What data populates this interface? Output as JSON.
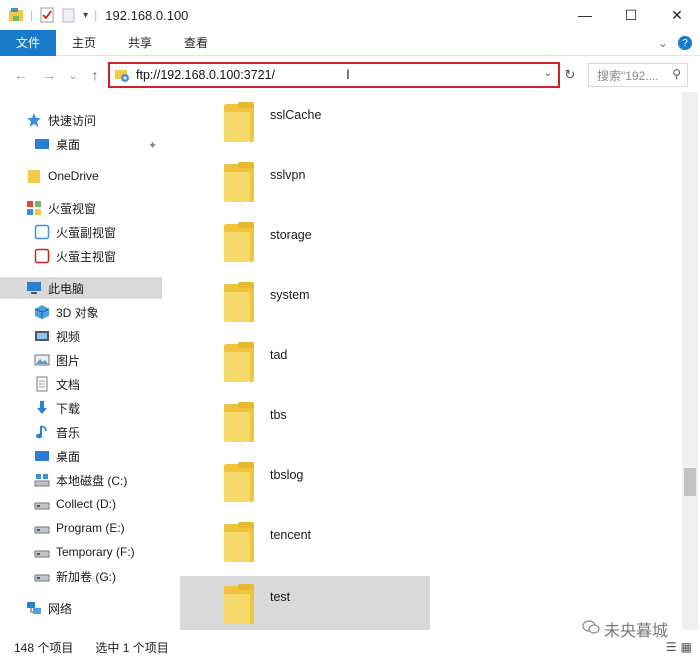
{
  "window": {
    "title": "192.168.0.100",
    "minimize": "—",
    "maximize": "☐",
    "close": "✕"
  },
  "ribbon": {
    "tabs": [
      "文件",
      "主页",
      "共享",
      "查看"
    ],
    "collapse": "⌄",
    "help": "?"
  },
  "nav": {
    "back": "←",
    "forward": "→",
    "recent": "⌄",
    "up": "↑",
    "address": "ftp://192.168.0.100:3721/",
    "refresh": "↻",
    "search_placeholder": "搜索\"192....",
    "search_icon": "⚲"
  },
  "sidebar": {
    "items": [
      {
        "label": "快速访问",
        "icon": "star-icon"
      },
      {
        "label": "桌面",
        "icon": "desktop-icon"
      },
      {
        "label": "OneDrive",
        "icon": "folder-icon"
      },
      {
        "label": "火萤视窗",
        "icon": "app-icon"
      },
      {
        "label": "火萤副视窗",
        "icon": "app-icon"
      },
      {
        "label": "火萤主视窗",
        "icon": "app-icon"
      },
      {
        "label": "此电脑",
        "icon": "computer-icon"
      },
      {
        "label": "3D 对象",
        "icon": "3d-icon"
      },
      {
        "label": "视频",
        "icon": "video-icon"
      },
      {
        "label": "图片",
        "icon": "picture-icon"
      },
      {
        "label": "文档",
        "icon": "document-icon"
      },
      {
        "label": "下载",
        "icon": "download-icon"
      },
      {
        "label": "音乐",
        "icon": "music-icon"
      },
      {
        "label": "桌面",
        "icon": "desktop-icon"
      },
      {
        "label": "本地磁盘 (C:)",
        "icon": "drive-icon"
      },
      {
        "label": "Collect (D:)",
        "icon": "drive-icon"
      },
      {
        "label": "Program (E:)",
        "icon": "drive-icon"
      },
      {
        "label": "Temporary (F:)",
        "icon": "drive-icon"
      },
      {
        "label": "新加卷 (G:)",
        "icon": "drive-icon"
      },
      {
        "label": "网络",
        "icon": "network-icon"
      }
    ],
    "pin": "📌"
  },
  "folders": [
    "sslCache",
    "sslvpn",
    "storage",
    "system",
    "tad",
    "tbs",
    "tbslog",
    "tencent",
    "test"
  ],
  "status": {
    "count": "148 个项目",
    "selected": "选中 1 个项目"
  },
  "watermark": "未央暮城",
  "colors": {
    "file_tab": "#1979ca",
    "address_border": "#d0202a",
    "selection": "#d9d9d9",
    "folder": "#f0c43c"
  }
}
